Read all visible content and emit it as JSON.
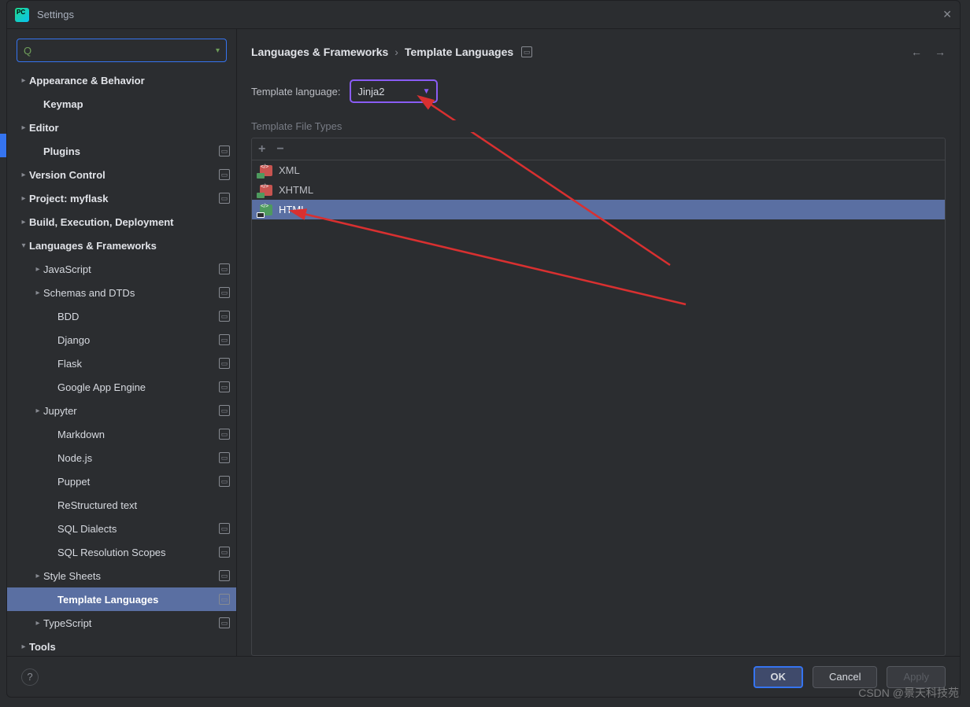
{
  "window": {
    "title": "Settings"
  },
  "search": {
    "placeholder": ""
  },
  "sidebar": [
    {
      "label": "Appearance & Behavior",
      "kind": "collapsed",
      "bold": true,
      "indent": 0,
      "mod": false
    },
    {
      "label": "Keymap",
      "kind": "leaf",
      "bold": true,
      "indent": 1,
      "mod": false
    },
    {
      "label": "Editor",
      "kind": "collapsed",
      "bold": true,
      "indent": 0,
      "mod": false
    },
    {
      "label": "Plugins",
      "kind": "leaf",
      "bold": true,
      "indent": 1,
      "mod": true
    },
    {
      "label": "Version Control",
      "kind": "collapsed",
      "bold": true,
      "indent": 0,
      "mod": true
    },
    {
      "label": "Project: myflask",
      "kind": "collapsed",
      "bold": true,
      "indent": 0,
      "mod": true
    },
    {
      "label": "Build, Execution, Deployment",
      "kind": "collapsed",
      "bold": true,
      "indent": 0,
      "mod": false
    },
    {
      "label": "Languages & Frameworks",
      "kind": "expanded",
      "bold": true,
      "indent": 0,
      "mod": false
    },
    {
      "label": "JavaScript",
      "kind": "collapsed",
      "bold": false,
      "indent": 1,
      "mod": true
    },
    {
      "label": "Schemas and DTDs",
      "kind": "collapsed",
      "bold": false,
      "indent": 1,
      "mod": true
    },
    {
      "label": "BDD",
      "kind": "leaf",
      "bold": false,
      "indent": 2,
      "mod": true
    },
    {
      "label": "Django",
      "kind": "leaf",
      "bold": false,
      "indent": 2,
      "mod": true
    },
    {
      "label": "Flask",
      "kind": "leaf",
      "bold": false,
      "indent": 2,
      "mod": true
    },
    {
      "label": "Google App Engine",
      "kind": "leaf",
      "bold": false,
      "indent": 2,
      "mod": true
    },
    {
      "label": "Jupyter",
      "kind": "collapsed",
      "bold": false,
      "indent": 1,
      "mod": true
    },
    {
      "label": "Markdown",
      "kind": "leaf",
      "bold": false,
      "indent": 2,
      "mod": true
    },
    {
      "label": "Node.js",
      "kind": "leaf",
      "bold": false,
      "indent": 2,
      "mod": true
    },
    {
      "label": "Puppet",
      "kind": "leaf",
      "bold": false,
      "indent": 2,
      "mod": true
    },
    {
      "label": "ReStructured text",
      "kind": "leaf",
      "bold": false,
      "indent": 2,
      "mod": false
    },
    {
      "label": "SQL Dialects",
      "kind": "leaf",
      "bold": false,
      "indent": 2,
      "mod": true
    },
    {
      "label": "SQL Resolution Scopes",
      "kind": "leaf",
      "bold": false,
      "indent": 2,
      "mod": true
    },
    {
      "label": "Style Sheets",
      "kind": "collapsed",
      "bold": false,
      "indent": 1,
      "mod": true
    },
    {
      "label": "Template Languages",
      "kind": "leaf",
      "bold": false,
      "indent": 2,
      "mod": true,
      "selected": true
    },
    {
      "label": "TypeScript",
      "kind": "collapsed",
      "bold": false,
      "indent": 1,
      "mod": true
    },
    {
      "label": "Tools",
      "kind": "collapsed",
      "bold": true,
      "indent": 0,
      "mod": false
    }
  ],
  "breadcrumb": {
    "root": "Languages & Frameworks",
    "page": "Template Languages"
  },
  "form": {
    "template_language_label": "Template language:",
    "template_language_value": "Jinja2",
    "file_types_label": "Template File Types"
  },
  "file_types": [
    {
      "name": "XML",
      "icon": "xml",
      "selected": false
    },
    {
      "name": "XHTML",
      "icon": "xhtml",
      "selected": false
    },
    {
      "name": "HTML",
      "icon": "html",
      "selected": true
    }
  ],
  "buttons": {
    "ok": "OK",
    "cancel": "Cancel",
    "apply": "Apply"
  },
  "watermark": "CSDN @景天科技苑"
}
